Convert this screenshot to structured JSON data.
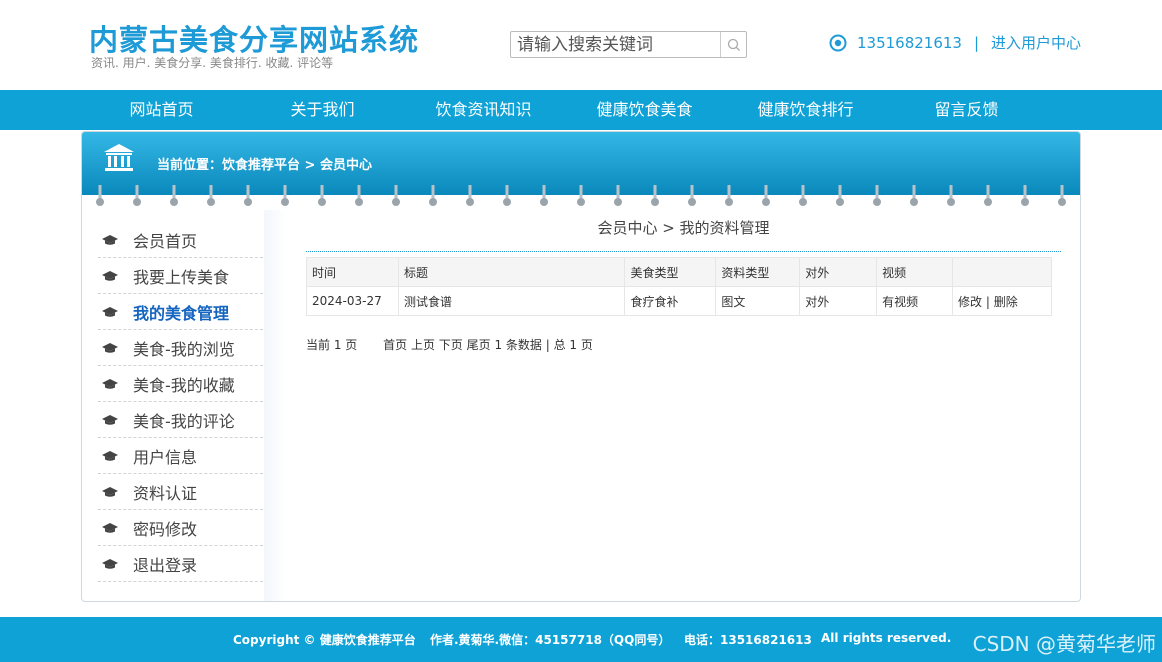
{
  "header": {
    "site_title": "内蒙古美食分享网站系统",
    "site_subtitle": "资讯. 用户. 美食分享. 美食排行. 收藏. 评论等",
    "search_placeholder": "请输入搜索关键词",
    "phone": "13516821613",
    "separator": "|",
    "user_center": "进入用户中心"
  },
  "nav": {
    "items": [
      {
        "label": "网站首页"
      },
      {
        "label": "关于我们"
      },
      {
        "label": "饮食资讯知识"
      },
      {
        "label": "健康饮食美食"
      },
      {
        "label": "健康饮食排行"
      },
      {
        "label": "留言反馈"
      }
    ]
  },
  "breadcrumb": "当前位置：饮食推荐平台 > 会员中心",
  "sidebar": {
    "items": [
      {
        "label": "会员首页",
        "active": false
      },
      {
        "label": "我要上传美食",
        "active": false
      },
      {
        "label": "我的美食管理",
        "active": true
      },
      {
        "label": "美食-我的浏览",
        "active": false
      },
      {
        "label": "美食-我的收藏",
        "active": false
      },
      {
        "label": "美食-我的评论",
        "active": false
      },
      {
        "label": "用户信息",
        "active": false
      },
      {
        "label": "资料认证",
        "active": false
      },
      {
        "label": "密码修改",
        "active": false
      },
      {
        "label": "退出登录",
        "active": false
      }
    ]
  },
  "content": {
    "title": "会员中心 > 我的资料管理",
    "table": {
      "headers": [
        "时间",
        "标题",
        "美食类型",
        "资料类型",
        "对外",
        "视频",
        ""
      ],
      "rows": [
        {
          "time": "2024-03-27",
          "title": "测试食谱",
          "food_type": "食疗食补",
          "data_type": "图文",
          "public": "对外",
          "video": "有视频",
          "edit": "修改",
          "divider": "|",
          "delete": "删除"
        }
      ]
    },
    "pager": {
      "current": "当前 1 页",
      "first": "首页",
      "prev": "上页",
      "next": "下页",
      "last": "尾页",
      "summary": "1 条数据 | 总 1 页"
    }
  },
  "footer": {
    "copyright": "Copyright © 健康饮食推荐平台",
    "author": "作者.黄菊华.微信：45157718（QQ同号）",
    "phone": "电话：13516821613",
    "rights": "All rights reserved.",
    "watermark": "CSDN @黄菊华老师"
  },
  "colors": {
    "primary": "#0ea2d6",
    "title_blue": "#1e9ad6",
    "active_link": "#1565c0"
  },
  "icons": {
    "search": "search-icon",
    "contact": "target-icon",
    "breadcrumb": "bank-icon",
    "sidebar": "graduation-cap-icon"
  }
}
